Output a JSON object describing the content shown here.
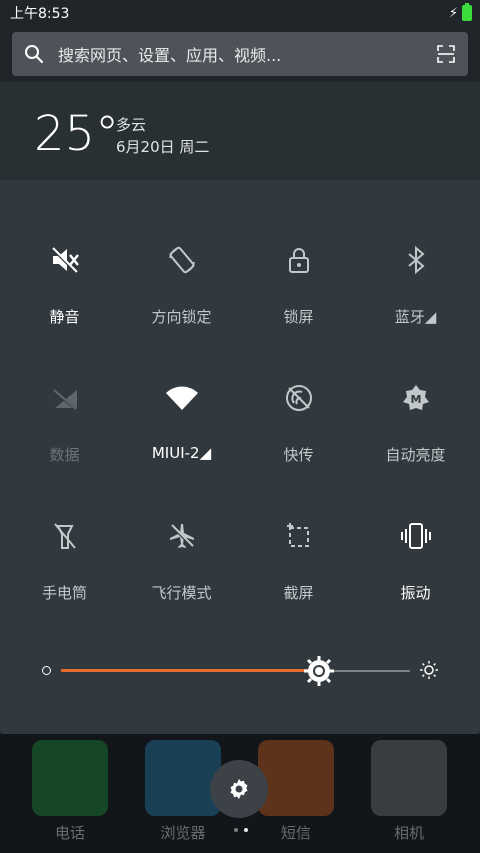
{
  "status": {
    "time": "上午8:53"
  },
  "search": {
    "placeholder": "搜索网页、设置、应用、视频..."
  },
  "weather": {
    "temp": "25°",
    "condition": "多云",
    "date": "6月20日 周二"
  },
  "tiles": [
    {
      "label": "静音",
      "icon": "mute-icon",
      "state": "active"
    },
    {
      "label": "方向锁定",
      "icon": "rotation-lock-icon",
      "state": "normal"
    },
    {
      "label": "锁屏",
      "icon": "lock-icon",
      "state": "normal"
    },
    {
      "label": "蓝牙◢",
      "icon": "bluetooth-icon",
      "state": "normal"
    },
    {
      "label": "数据",
      "icon": "mobile-data-icon",
      "state": "disabled"
    },
    {
      "label": "MIUI-2◢",
      "icon": "wifi-icon",
      "state": "active"
    },
    {
      "label": "快传",
      "icon": "quick-transfer-icon",
      "state": "normal"
    },
    {
      "label": "自动亮度",
      "icon": "auto-brightness-icon",
      "state": "normal"
    },
    {
      "label": "手电筒",
      "icon": "flashlight-icon",
      "state": "normal"
    },
    {
      "label": "飞行模式",
      "icon": "airplane-icon",
      "state": "normal"
    },
    {
      "label": "截屏",
      "icon": "screenshot-icon",
      "state": "normal"
    },
    {
      "label": "振动",
      "icon": "vibrate-icon",
      "state": "active"
    }
  ],
  "brightness": {
    "level": 0.74
  },
  "dock": {
    "apps": [
      {
        "label": "电话",
        "color": "#1fa33a"
      },
      {
        "label": "浏览器",
        "color": "#2a8fc8"
      },
      {
        "label": "短信",
        "color": "#ef6a1f"
      },
      {
        "label": "相机",
        "color": "#888888"
      }
    ]
  },
  "colors": {
    "accent": "#e26b2f",
    "panel": "#31393e"
  }
}
